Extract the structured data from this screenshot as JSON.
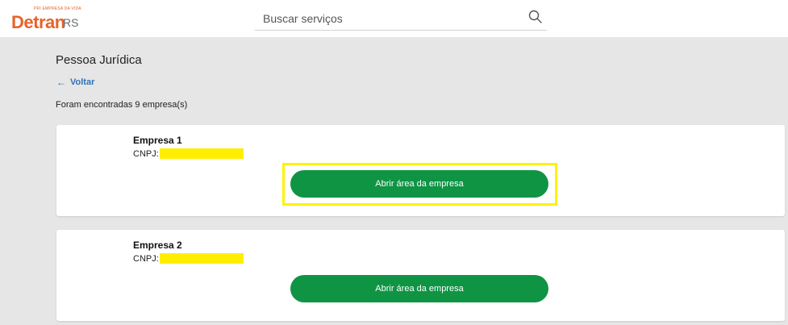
{
  "header": {
    "logo_tagline": "PRI EMPRESA DA VIDA",
    "logo_main": "Detran",
    "logo_suffix": "RS",
    "search": {
      "placeholder": "Buscar serviços"
    }
  },
  "main": {
    "title": "Pessoa Jurídica",
    "back_label": "Voltar",
    "results_text": "Foram encontradas 9 empresa(s)",
    "companies": [
      {
        "name": "Empresa 1",
        "cnpj_label": "CNPJ:",
        "button_label": "Abrir área da empresa"
      },
      {
        "name": "Empresa 2",
        "cnpj_label": "CNPJ:",
        "button_label": "Abrir área da empresa"
      }
    ]
  },
  "colors": {
    "brand_orange": "#e8622a",
    "button_green": "#0f9444",
    "link_blue": "#2e74b5",
    "highlight_yellow": "#fff200",
    "redaction_yellow": "#ffee00"
  }
}
